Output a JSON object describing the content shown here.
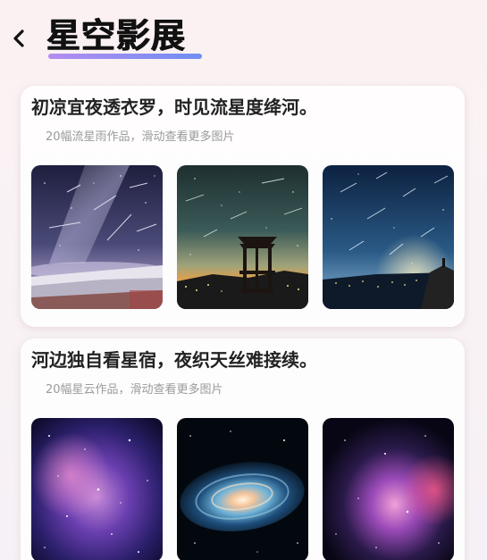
{
  "header": {
    "title": "星空影展",
    "back_icon": "chevron-left-icon"
  },
  "sections": [
    {
      "title": "初凉宜夜透衣罗，时见流星度绛河。",
      "subtitle": "20幅流星雨作品，滑动查看更多图片",
      "images": [
        "meteor-snowfield-image",
        "meteor-pavilion-image",
        "meteor-city-image"
      ]
    },
    {
      "title": "河边独自看星宿，夜织天丝难接续。",
      "subtitle": "20幅星云作品，滑动查看更多图片",
      "images": [
        "nebula-purple-image",
        "galaxy-spiral-image",
        "nebula-pink-image"
      ]
    }
  ],
  "colors": {
    "accent_gradient_start": "#b48cf0",
    "accent_gradient_end": "#6f8ff2",
    "title_text": "#111111",
    "subtitle_text": "#9a9a9a"
  }
}
